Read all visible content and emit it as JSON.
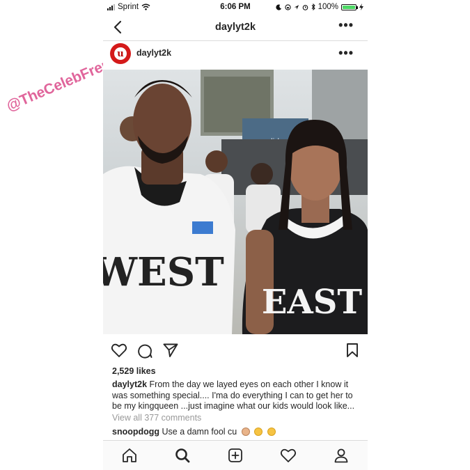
{
  "status_bar": {
    "carrier": "Sprint",
    "time": "6:06 PM",
    "battery": "100%"
  },
  "nav": {
    "title": "daylyt2k"
  },
  "post": {
    "username": "daylyt2k",
    "avatar_letter": "u",
    "likes": "2,529 likes",
    "caption_user": "daylyt2k",
    "caption_text": "From the day we layed eyes on each other I know it was something special.... I'ma do everything I can to get her to be my kingqueen ...just imagine what our kids would look like...",
    "view_comments": "View all 377 comments",
    "comment_user": "snoopdogg",
    "comment_text": "Use a damn fool cu"
  },
  "photo": {
    "left_jersey_text": "WEST",
    "right_jersey_text": "EAST",
    "brand": "adidas"
  },
  "watermark": "@TheCelebFrenzy",
  "colors": {
    "accent_red": "#d41a1a",
    "watermark_pink": "#e0659b",
    "battery_green": "#4cd964"
  }
}
